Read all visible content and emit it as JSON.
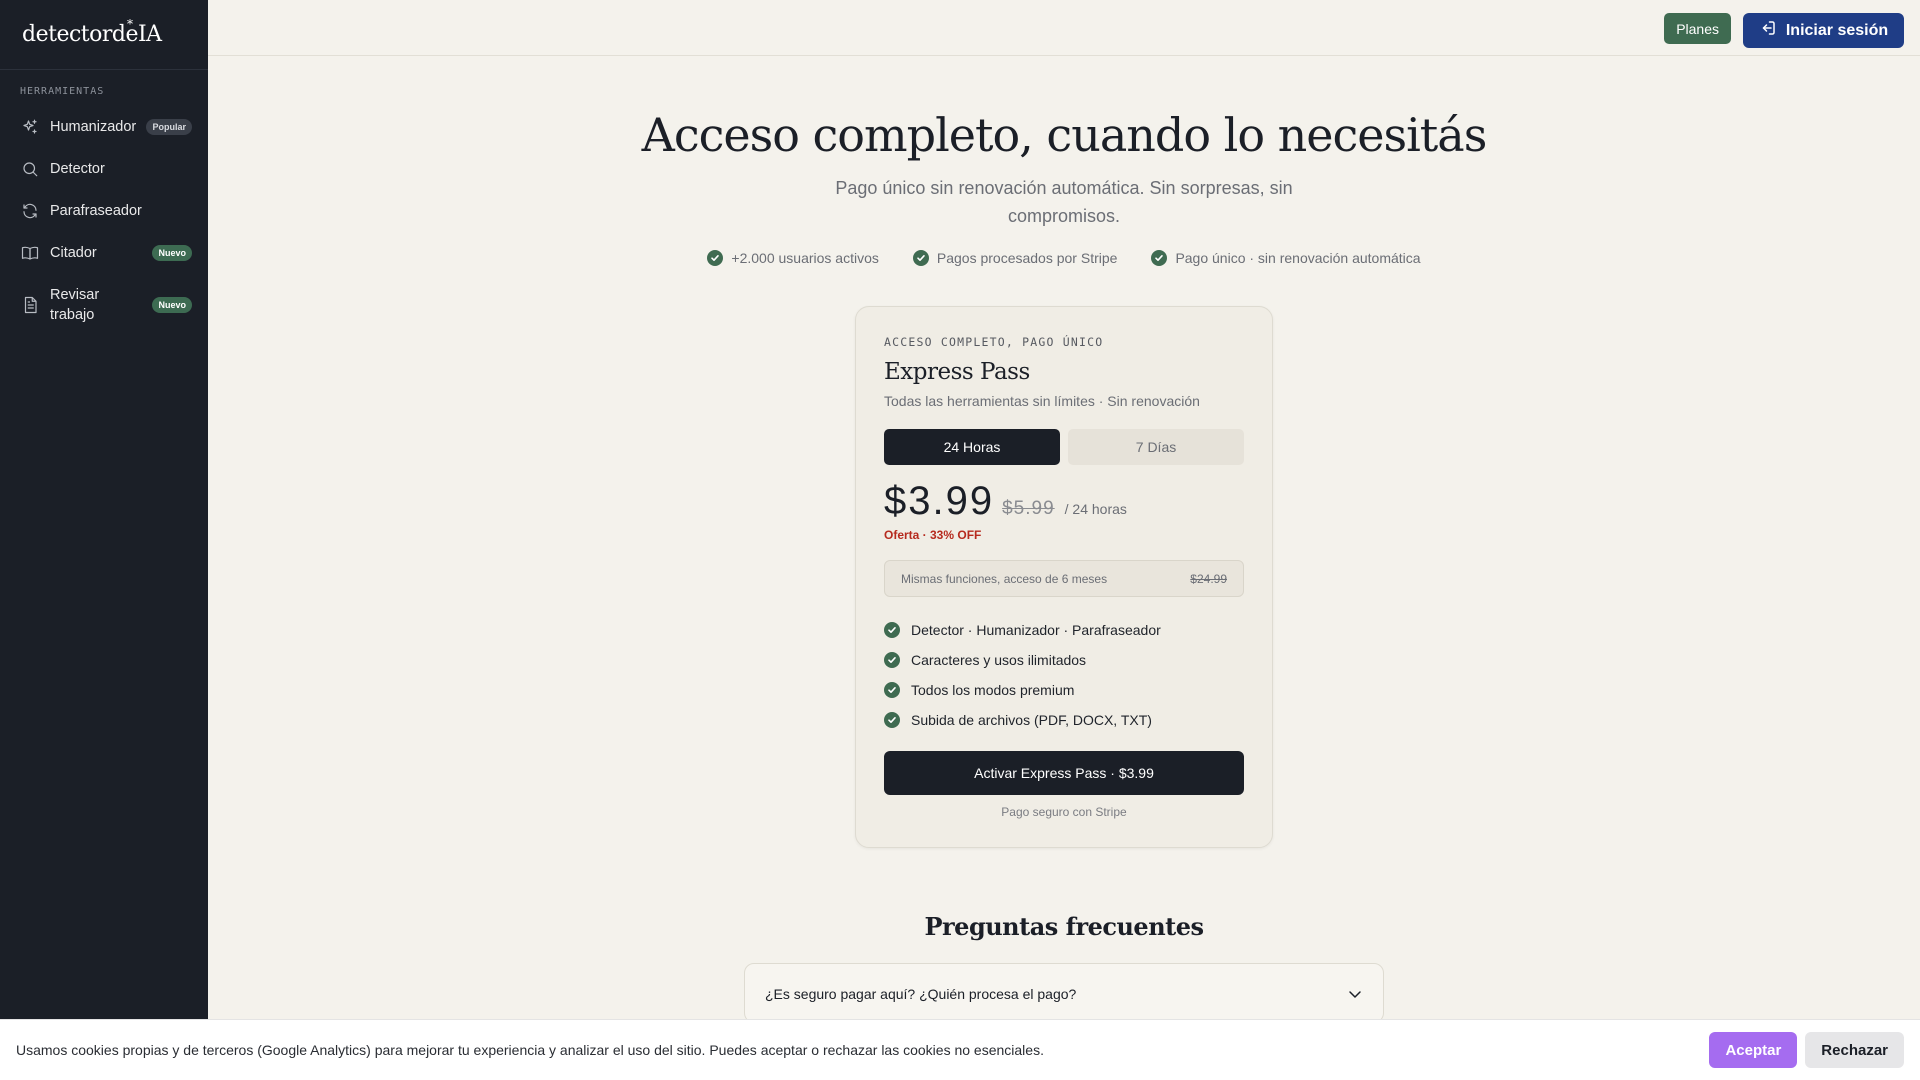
{
  "brand": {
    "logo_text": "detectordeIA",
    "logo_star": "*"
  },
  "sidebar": {
    "section_label": "HERRAMIENTAS",
    "items": [
      {
        "label": "Humanizador",
        "badge": "Popular",
        "icon": "sparkles-icon"
      },
      {
        "label": "Detector",
        "badge": "",
        "icon": "search-icon"
      },
      {
        "label": "Parafraseador",
        "badge": "",
        "icon": "refresh-icon"
      },
      {
        "label": "Citador",
        "badge": "Nuevo",
        "icon": "book-icon"
      },
      {
        "label": "Revisar trabajo",
        "badge": "Nuevo",
        "icon": "document-icon"
      }
    ]
  },
  "header": {
    "planes_label": "Planes",
    "login_label": "Iniciar sesión"
  },
  "hero": {
    "title": "Acceso completo, cuando lo necesitás",
    "subtitle": "Pago único sin renovación automática. Sin sorpresas, sin compromisos.",
    "trust": [
      "+2.000 usuarios activos",
      "Pagos procesados por Stripe",
      "Pago único · sin renovación automática"
    ]
  },
  "card": {
    "kicker": "ACCESO COMPLETO, PAGO ÚNICO",
    "title": "Express Pass",
    "subtitle": "Todas las herramientas sin límites · Sin renovación",
    "toggle": {
      "option1": "24 Horas",
      "option2": "7 Días",
      "selected": "24 Horas"
    },
    "price": "$3.99",
    "old_price": "$5.99",
    "period": "/ 24 horas",
    "offer": "Oferta · 33% OFF",
    "alt_text": "Mismas funciones, acceso de 6 meses",
    "alt_price": "$24.99",
    "features": [
      "Detector · Humanizador · Parafraseador",
      "Caracteres y usos ilimitados",
      "Todos los modos premium",
      "Subida de archivos (PDF, DOCX, TXT)"
    ],
    "cta": "Activar Express Pass · $3.99",
    "secure": "Pago seguro con Stripe"
  },
  "faq": {
    "title": "Preguntas frecuentes",
    "items": [
      "¿Es seguro pagar aquí? ¿Quién procesa el pago?"
    ]
  },
  "cookie": {
    "text": "Usamos cookies propias y de terceros (Google Analytics) para mejorar tu experiencia y analizar el uso del sitio. Puedes aceptar o rechazar las cookies no esenciales.",
    "accept": "Aceptar",
    "reject": "Rechazar"
  },
  "colors": {
    "sidebar_bg": "#1b1f27",
    "page_bg": "#f4f2ec",
    "green": "#3f6b51",
    "navy": "#1f3d86",
    "offer_red": "#b62a1e",
    "accept_purple": "#a56cf0"
  }
}
